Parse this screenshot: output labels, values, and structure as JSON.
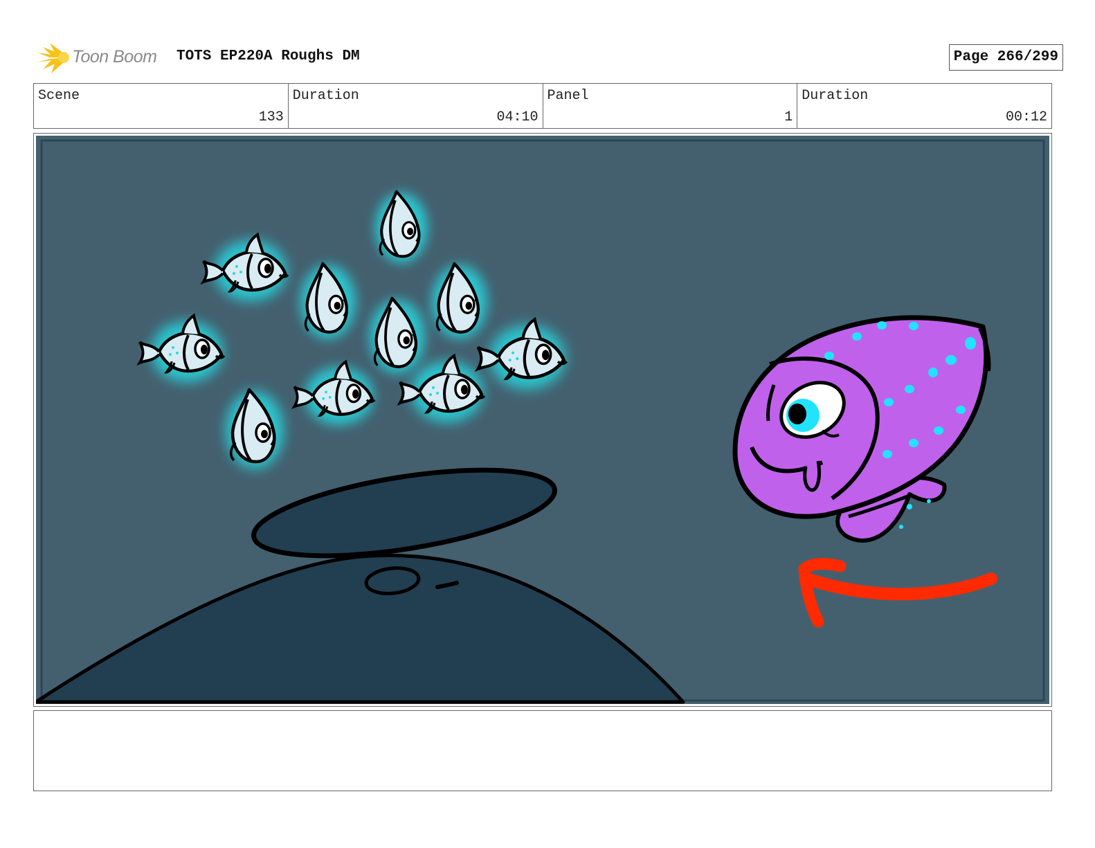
{
  "header": {
    "logo_text": "Toon Boom",
    "title": "TOTS EP220A Roughs DM",
    "page": "Page 266/299"
  },
  "info": {
    "scene_label": "Scene",
    "scene_value": "133",
    "scene_duration_label": "Duration",
    "scene_duration_value": "04:10",
    "panel_label": "Panel",
    "panel_value": "1",
    "panel_duration_label": "Duration",
    "panel_duration_value": "00:12"
  },
  "colors": {
    "water": "#44606f",
    "rock": "#223f51",
    "small_fish_glow": "#27d8e0",
    "small_fish_body": "#d9ecf3",
    "big_fish_body": "#c061ec",
    "big_fish_spots": "#22e3ff",
    "arrow": "#ff2a00",
    "logo_yellow": "#f6c21a"
  },
  "notes": ""
}
